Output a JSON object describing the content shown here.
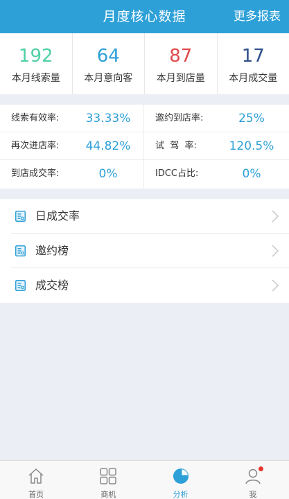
{
  "header": {
    "title": "月度核心数据",
    "more_label": "更多报表"
  },
  "stats": [
    {
      "value": "192",
      "label": "本月线索量",
      "color": "#4fd1a5"
    },
    {
      "value": "64",
      "label": "本月意向客",
      "color": "#2ea0d8"
    },
    {
      "value": "87",
      "label": "本月到店量",
      "color": "#e04848"
    },
    {
      "value": "17",
      "label": "本月成交量",
      "color": "#2d4f8a"
    }
  ],
  "rates": [
    {
      "left_label": "线索有效率:",
      "left_value": "33.33%",
      "right_label": "邀约到店率:",
      "right_value": "25%"
    },
    {
      "left_label": "再次进店率:",
      "left_value": "44.82%",
      "right_label": "试  驾  率:",
      "right_value": "120.5%"
    },
    {
      "left_label": "到店成交率:",
      "left_value": "0%",
      "right_label": "IDCC占比:",
      "right_value": "0%"
    }
  ],
  "menu": [
    {
      "label": "日成交率",
      "icon": "report-icon"
    },
    {
      "label": "邀约榜",
      "icon": "report-icon"
    },
    {
      "label": "成交榜",
      "icon": "report-icon"
    }
  ],
  "tabs": [
    {
      "label": "首页",
      "icon": "home-icon"
    },
    {
      "label": "商机",
      "icon": "grid-icon"
    },
    {
      "label": "分析",
      "icon": "pie-chart-icon",
      "active": true
    },
    {
      "label": "我",
      "icon": "person-icon",
      "badge": true
    }
  ],
  "accent_color": "#2ea0d8"
}
